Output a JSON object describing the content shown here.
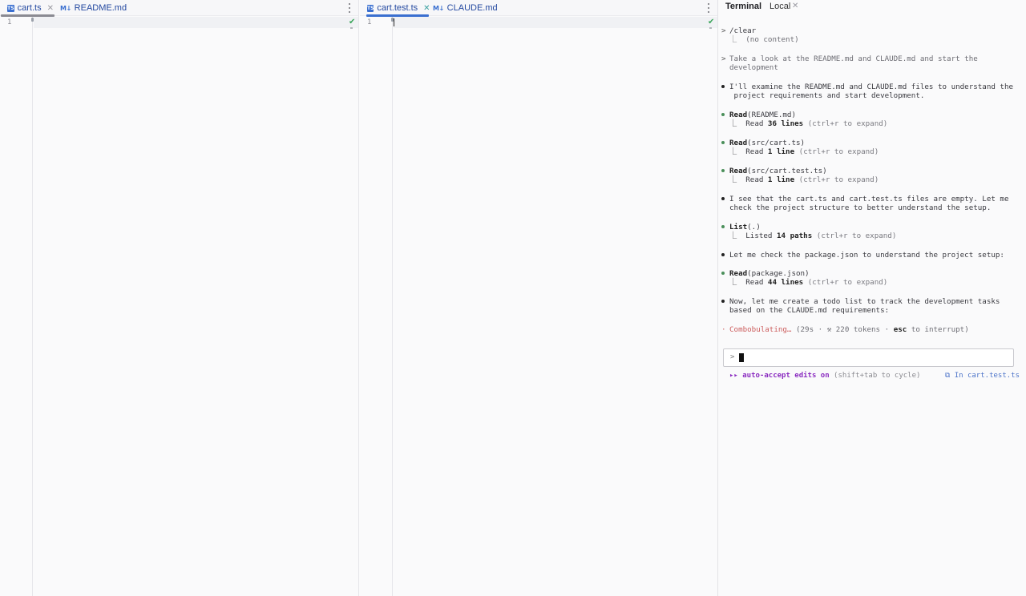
{
  "editor_left": {
    "tabs": [
      {
        "icon": "TS",
        "label": "cart.ts",
        "active": true
      },
      {
        "icon": "M↓",
        "label": "README.md",
        "active": false
      }
    ],
    "line_number": "1"
  },
  "editor_right": {
    "tabs": [
      {
        "icon": "TS",
        "label": "cart.test.ts",
        "active": true
      },
      {
        "icon": "M↓",
        "label": "CLAUDE.md",
        "active": false
      }
    ],
    "line_number": "1"
  },
  "terminal": {
    "title": "Terminal",
    "session_tab": "Local",
    "lines": {
      "clear_cmd": "/clear",
      "clear_result": "⎿  (no content)",
      "user_prompt_1": "Take a look at the README.md and CLAUDE.md and start the",
      "user_prompt_2": "development",
      "msg1_1": "I'll examine the README.md and CLAUDE.md files to understand the",
      "msg1_2": " project requirements and start development.",
      "read1_tool": "Read",
      "read1_arg": "(README.md)",
      "read1_prefix": "⎿  Read ",
      "read1_count": "36 lines",
      "read1_hint": " (ctrl+r to expand)",
      "read2_tool": "Read",
      "read2_arg": "(src/cart.ts)",
      "read2_prefix": "⎿  Read ",
      "read2_count": "1 line",
      "read2_hint": " (ctrl+r to expand)",
      "read3_tool": "Read",
      "read3_arg": "(src/cart.test.ts)",
      "read3_prefix": "⎿  Read ",
      "read3_count": "1 line",
      "read3_hint": " (ctrl+r to expand)",
      "msg2_1": "I see that the cart.ts and cart.test.ts files are empty. Let me",
      "msg2_2": "check the project structure to better understand the setup.",
      "list_tool": "List",
      "list_arg": "(.)",
      "list_prefix": "⎿  Listed ",
      "list_count": "14 paths",
      "list_hint": " (ctrl+r to expand)",
      "msg3": "Let me check the package.json to understand the project setup:",
      "read4_tool": "Read",
      "read4_arg": "(package.json)",
      "read4_prefix": "⎿  Read ",
      "read4_count": "44 lines",
      "read4_hint": " (ctrl+r to expand)",
      "msg4_1": "Now, let me create a todo list to track the development tasks",
      "msg4_2": "based on the CLAUDE.md requirements:",
      "spinner": "·",
      "status_word": "Combobulating…",
      "status_detail": " (29s · ⚒ 220 tokens · ",
      "status_esc": "esc",
      "status_tail": " to interrupt)"
    },
    "input": {
      "prompt": ">",
      "value": ""
    },
    "mode": {
      "arrows": "▸▸",
      "label": " auto-accept edits on",
      "hint": " (shift+tab to cycle)",
      "file_icon": "⧉",
      "file_ref": " In cart.test.ts"
    }
  },
  "colors": {
    "tab_underline_left": "#8a8a92",
    "tab_underline_right": "#3a6fd0",
    "check": "#3aa55a",
    "auto_accept": "#8a2bc0",
    "combobulating": "#cc5c5c"
  }
}
